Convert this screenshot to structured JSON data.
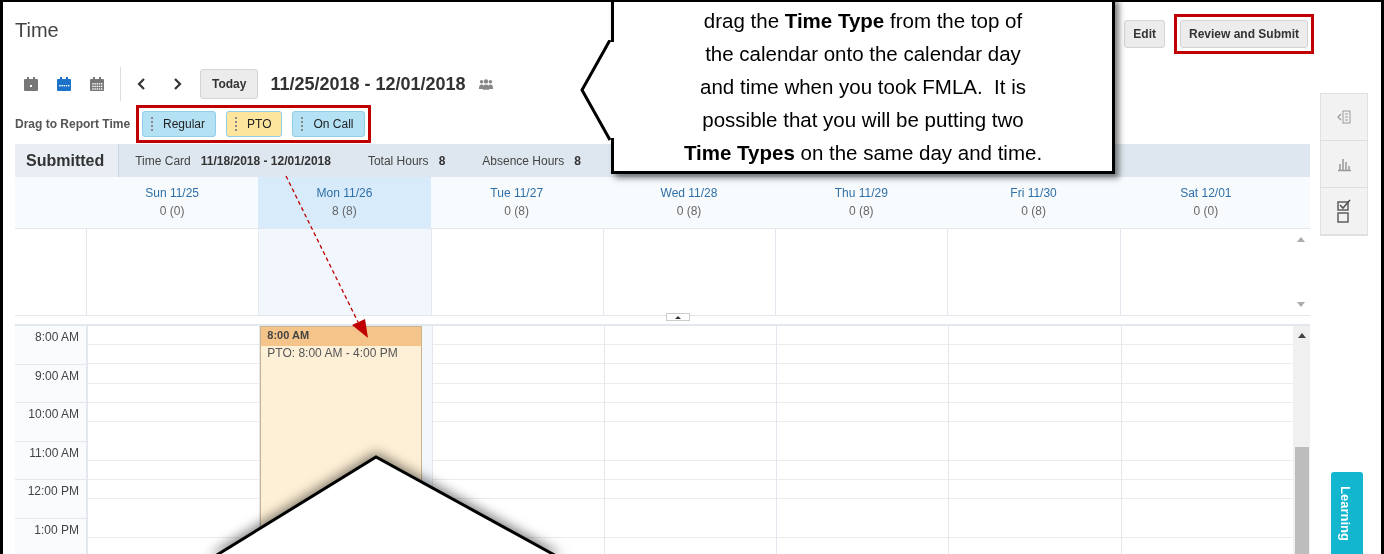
{
  "page": {
    "title": "Time"
  },
  "actions": [
    {
      "label": "Edit",
      "highlighted": false
    },
    {
      "label": "Review and Submit",
      "highlighted": true
    }
  ],
  "toolbar": {
    "views": [
      {
        "kind": "day",
        "selected": false
      },
      {
        "kind": "week",
        "selected": true
      },
      {
        "kind": "month",
        "selected": false
      }
    ],
    "today": "Today",
    "date_range": "11/25/2018 - 12/01/2018"
  },
  "time_types": {
    "label": "Drag to Report Time",
    "highlighted": true,
    "items": [
      {
        "label": "Regular",
        "color": "#b5e1f5"
      },
      {
        "label": "PTO",
        "color": "#fde59e"
      },
      {
        "label": "On Call",
        "color": "#b5e1f5"
      }
    ]
  },
  "summary": {
    "status": "Submitted",
    "fields": [
      {
        "label": "Time Card",
        "value": "11/18/2018 - 12/01/2018"
      },
      {
        "label": "Total Hours",
        "value": "8"
      },
      {
        "label": "Absence Hours",
        "value": "8"
      }
    ]
  },
  "days": [
    {
      "label": "Sun 11/25",
      "hours": "0 (0)",
      "selected": false
    },
    {
      "label": "Mon 11/26",
      "hours": "8 (8)",
      "selected": true,
      "events": [
        {
          "start": "8:00 AM",
          "text": "PTO: 8:00 AM - 4:00 PM"
        }
      ]
    },
    {
      "label": "Tue 11/27",
      "hours": "0 (8)",
      "selected": false
    },
    {
      "label": "Wed 11/28",
      "hours": "0 (8)",
      "selected": false
    },
    {
      "label": "Thu 11/29",
      "hours": "0 (8)",
      "selected": false
    },
    {
      "label": "Fri 11/30",
      "hours": "0 (8)",
      "selected": false
    },
    {
      "label": "Sat 12/01",
      "hours": "0 (0)",
      "selected": false
    }
  ],
  "times": [
    "8:00 AM",
    "9:00 AM",
    "10:00 AM",
    "11:00 AM",
    "12:00 PM",
    "1:00 PM"
  ],
  "side_tab": "Learning",
  "callout": {
    "lines": [
      "drag the **Time Type** from the top of",
      "the calendar onto the calendar day",
      "and time when you took FMLA.  It is",
      "possible that you will be putting two",
      "**Time Types** on the same day and time."
    ]
  }
}
